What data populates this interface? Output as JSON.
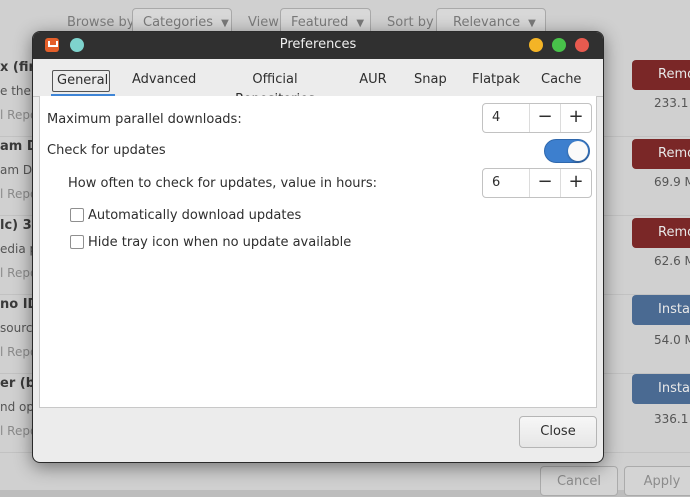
{
  "background": {
    "toolbar": {
      "browse_by_label": "Browse by",
      "browse_by_value": "Categories",
      "view_label": "View",
      "view_value": "Featured",
      "sort_by_label": "Sort by",
      "sort_by_value": "Relevance"
    },
    "packages": [
      {
        "name": "x (fire",
        "desc": "e the",
        "repo": "l Repo",
        "action": "Remo",
        "action_type": "remove",
        "size": "233.1"
      },
      {
        "name": "am D",
        "desc": "am De",
        "repo": "l Repo",
        "action": "Remo",
        "action_type": "remove",
        "size": "69.9 M"
      },
      {
        "name": "lc)  3.",
        "desc": "edia p",
        "repo": "l Repo",
        "action": "Remo",
        "action_type": "remove",
        "size": "62.6 M"
      },
      {
        "name": "no ID",
        "desc": "source",
        "repo": "l Repo",
        "action": "Insta",
        "action_type": "install",
        "size": "54.0 M"
      },
      {
        "name": "er (bl",
        "desc": "nd op",
        "repo": "l Repo",
        "action": "Insta",
        "action_type": "install",
        "size": "336.1"
      }
    ],
    "bottom_buttons": {
      "cancel": "Cancel",
      "apply": "Apply"
    }
  },
  "dialog": {
    "title": "Preferences",
    "tabs": [
      {
        "label": "General",
        "active": true
      },
      {
        "label": "Advanced",
        "active": false
      },
      {
        "label": "Official Repositories",
        "active": false
      },
      {
        "label": "AUR",
        "active": false
      },
      {
        "label": "Snap",
        "active": false
      },
      {
        "label": "Flatpak",
        "active": false
      },
      {
        "label": "Cache",
        "active": false
      }
    ],
    "general": {
      "max_parallel_label": "Maximum parallel downloads:",
      "max_parallel_value": "4",
      "check_updates_label": "Check for updates",
      "check_updates_enabled": true,
      "interval_label": "How often to check for updates, value in hours:",
      "interval_value": "6",
      "auto_download_label": "Automatically download updates",
      "auto_download_checked": false,
      "hide_tray_label": "Hide tray icon when no update available",
      "hide_tray_checked": false
    },
    "close_label": "Close",
    "spin_minus": "−",
    "spin_plus": "+"
  },
  "colors": {
    "accent": "#3f85d6",
    "titlebar": "#303030",
    "remove_button": "#7a2727",
    "install_button": "#4a6a92"
  }
}
